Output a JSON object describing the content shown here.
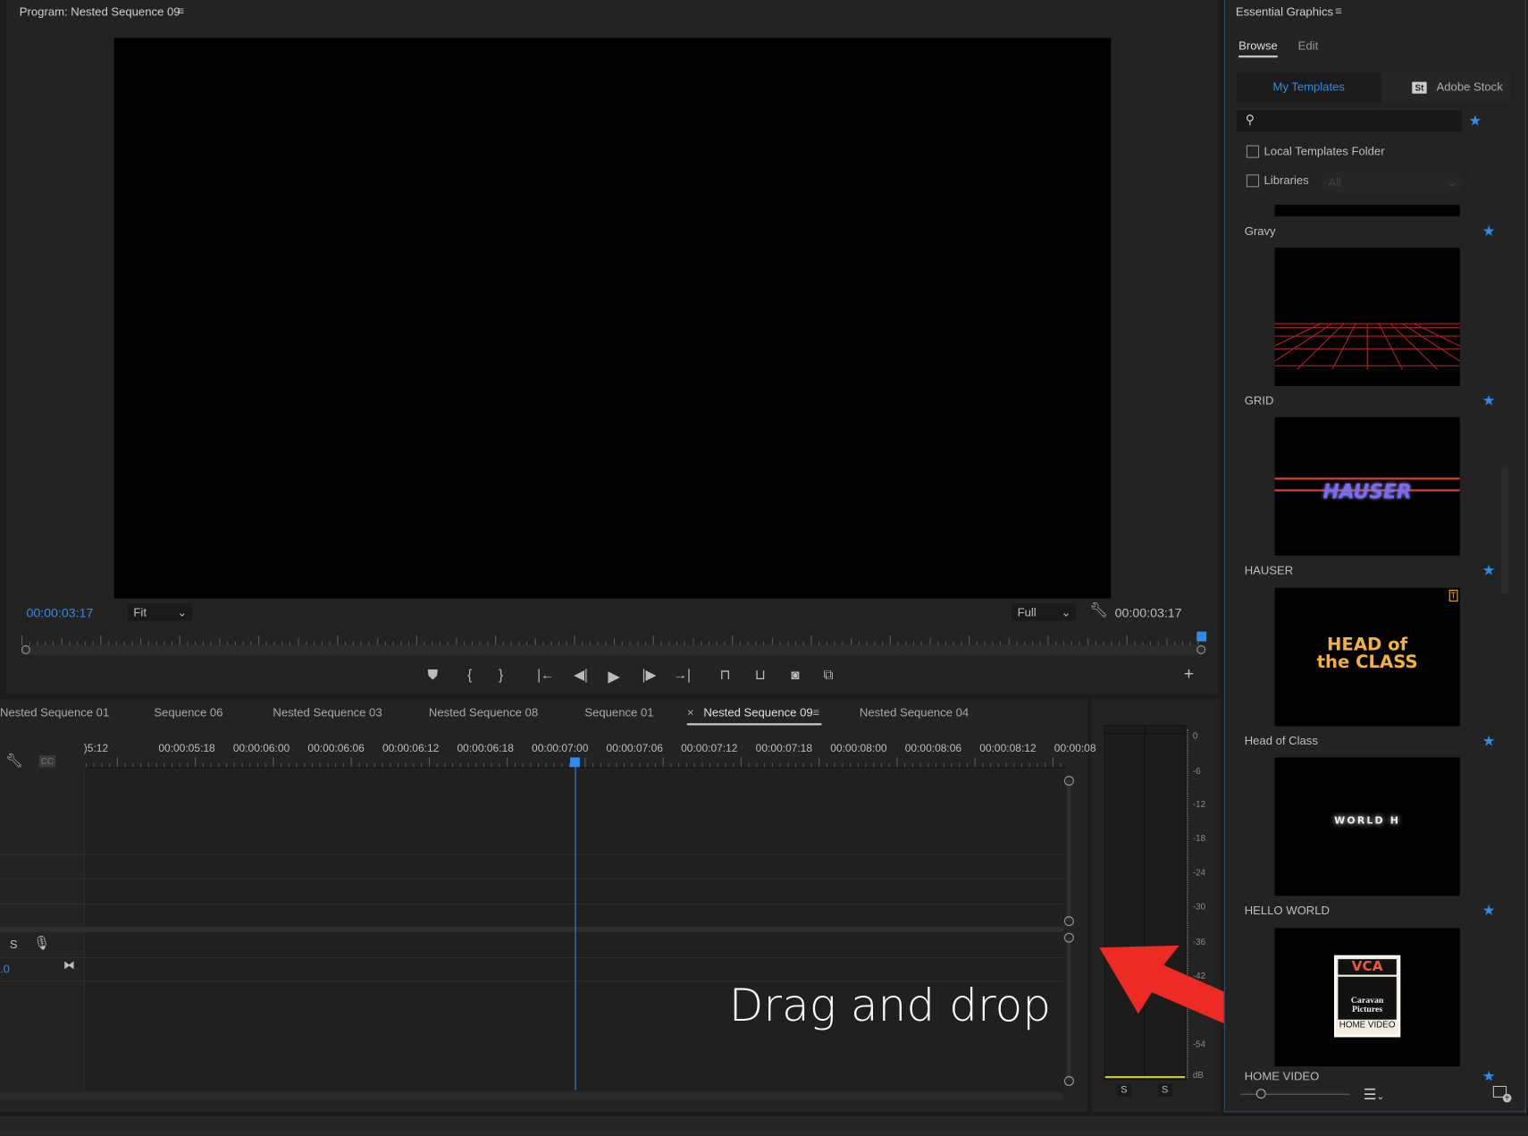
{
  "program": {
    "title": "Program: Nested Sequence 09",
    "timecode_left": "00:00:03:17",
    "fit": "Fit",
    "quality": "Full",
    "timecode_right": "00:00:03:17"
  },
  "timeline": {
    "tabs": [
      "Nested Sequence 01",
      "Sequence 06",
      "Nested Sequence 03",
      "Nested Sequence 08",
      "Sequence 01",
      "Nested Sequence 09",
      "Nested Sequence 04"
    ],
    "active_tab": "Nested Sequence 09",
    "close": "×",
    "ruler": [
      ")5:12",
      "00:00:05:18",
      "00:00:06:00",
      "00:00:06:06",
      "00:00:06:12",
      "00:00:06:18",
      "00:00:07:00",
      "00:00:07:06",
      "00:00:07:12",
      "00:00:07:18",
      "00:00:08:00",
      "00:00:08:06",
      "00:00:08:12",
      "00:00:08"
    ],
    "cc": "CC",
    "solo": "S",
    "volume": ".0"
  },
  "meter": {
    "scale": [
      "0",
      "-6",
      "-12",
      "-18",
      "-24",
      "-30",
      "-36",
      "-42",
      "-54",
      "dB"
    ],
    "solo": [
      "S",
      "S"
    ]
  },
  "annotation": {
    "text": "Drag and drop",
    "arrow_color": "#ee2a24"
  },
  "essential": {
    "title": "Essential Graphics",
    "tabs": [
      "Browse",
      "Edit"
    ],
    "my_templates": "My Templates",
    "stock_badge": "St",
    "adobe_stock": "Adobe Stock",
    "local_folder": "Local Templates Folder",
    "libraries": "Libraries",
    "libraries_select": "All",
    "templates": [
      {
        "name": "Gravy"
      },
      {
        "name": "GRID"
      },
      {
        "name": "HAUSER",
        "thumb_text": "HAUSER"
      },
      {
        "name": "Head of Class",
        "thumb_text": "HEAD of the CLASS"
      },
      {
        "name": "HELLO WORLD",
        "thumb_text": "WORLD H"
      },
      {
        "name": "HOME VIDEO",
        "thumb_text": [
          "VCA",
          "Caravan Pictures",
          "HOME VIDEO"
        ]
      }
    ]
  },
  "colors": {
    "accent": "#2d8ceb",
    "bg": "#232323"
  }
}
